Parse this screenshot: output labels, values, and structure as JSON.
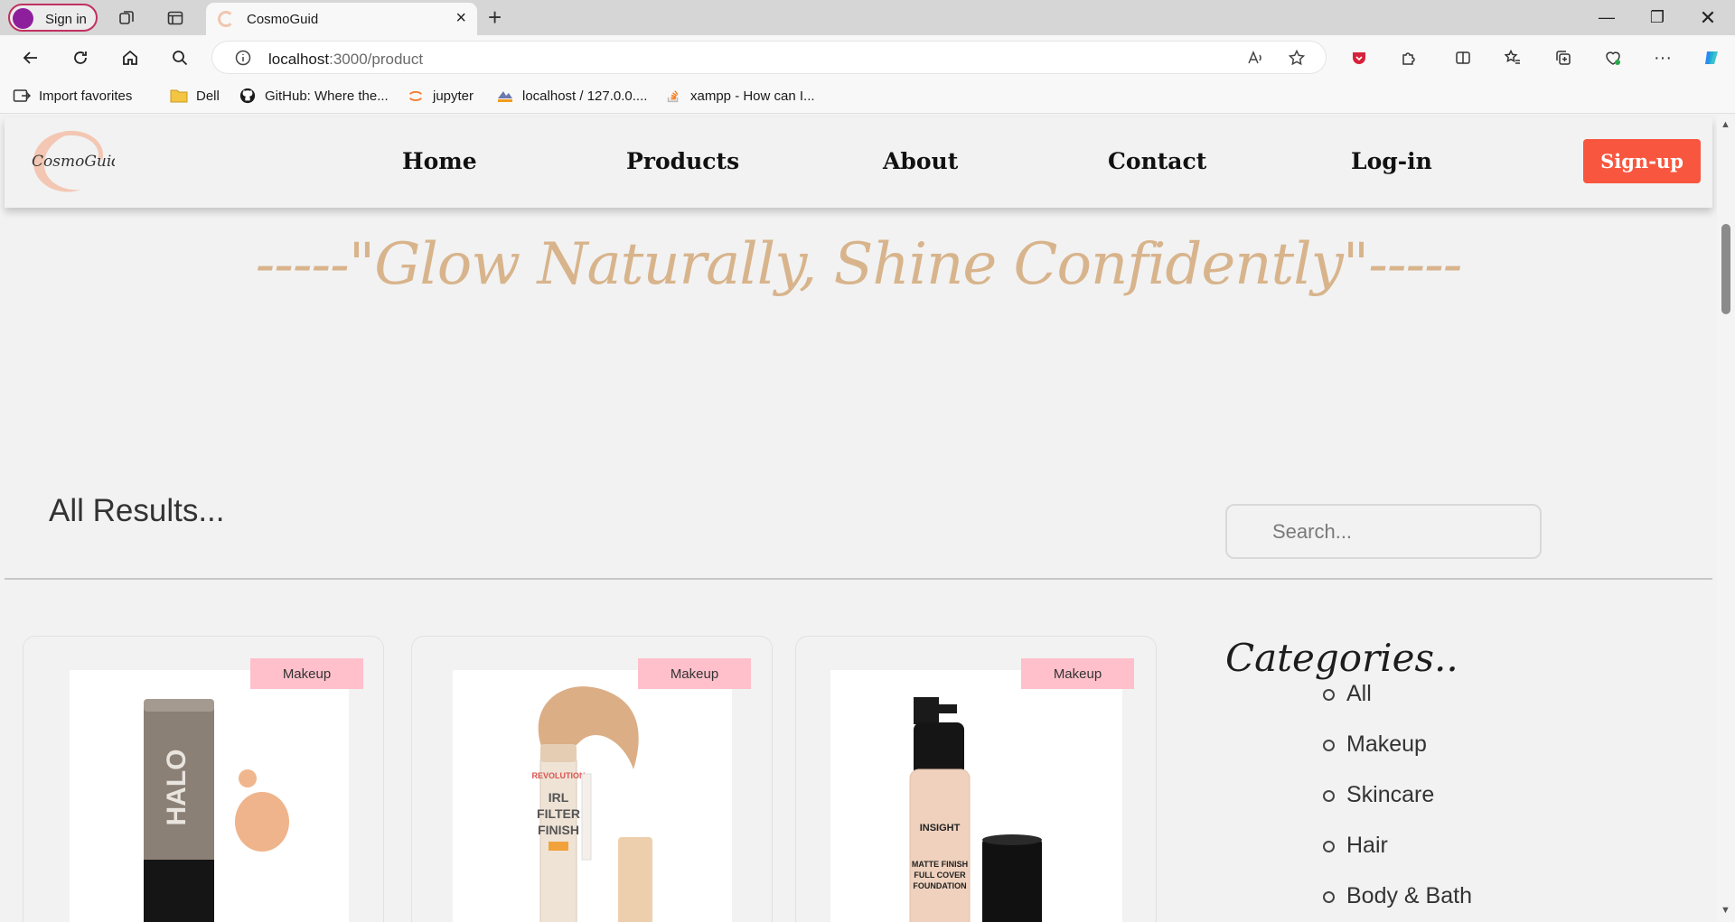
{
  "browser": {
    "profile_label": "Sign in",
    "tab_title": "CosmoGuid",
    "url_host": "localhost",
    "url_path": ":3000/product",
    "favorites": [
      {
        "label": "Import favorites",
        "icon": "import-icon"
      },
      {
        "label": "Dell",
        "icon": "folder-icon"
      },
      {
        "label": "GitHub: Where the...",
        "icon": "github-icon"
      },
      {
        "label": "jupyter",
        "icon": "jupyter-icon"
      },
      {
        "label": "localhost / 127.0.0....",
        "icon": "phpmyadmin-icon"
      },
      {
        "label": "xampp - How can I...",
        "icon": "stackoverflow-icon"
      }
    ]
  },
  "site": {
    "logo_text": "CosmoGuid",
    "nav": {
      "home": "Home",
      "products": "Products",
      "about": "About",
      "contact": "Contact",
      "login": "Log-in",
      "signup": "Sign-up"
    },
    "tagline": "-----\"Glow Naturally, Shine Confidently\"-----",
    "results_title": "All Results...",
    "search_placeholder": "Search...",
    "products": [
      {
        "badge": "Makeup",
        "image": "halo-tint-tube"
      },
      {
        "badge": "Makeup",
        "image": "irl-filter-finish-concealer"
      },
      {
        "badge": "Makeup",
        "image": "insight-matte-foundation"
      }
    ],
    "categories_title": "Categories..",
    "categories": [
      "All",
      "Makeup",
      "Skincare",
      "Hair",
      "Body & Bath"
    ]
  },
  "colors": {
    "accent": "#f8563f",
    "tagline": "#d8b48c",
    "badge": "#ffc0cb",
    "page_bg": "#f2f2f2"
  }
}
